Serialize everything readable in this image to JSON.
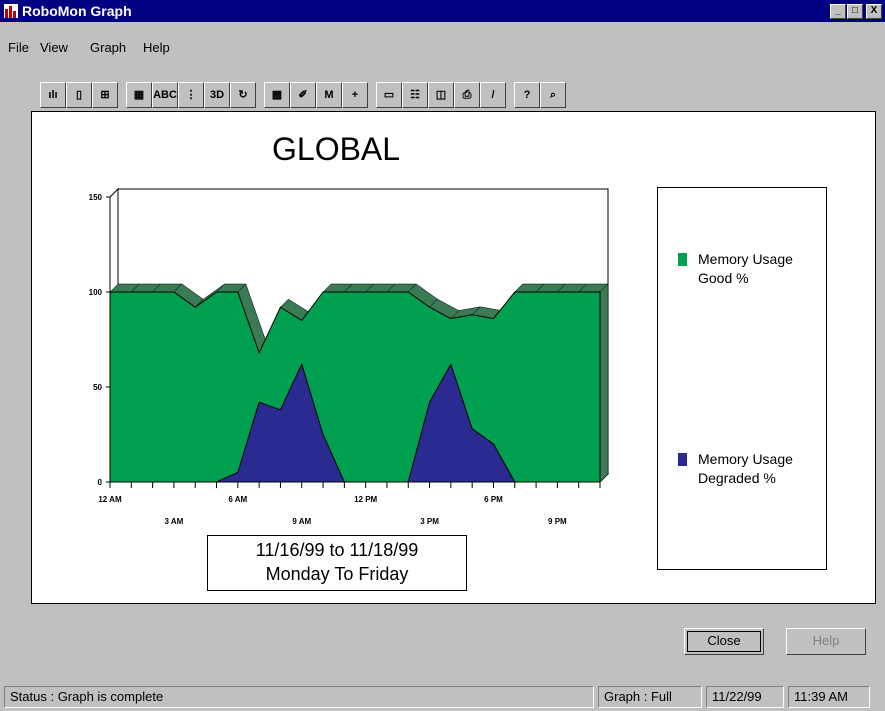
{
  "window": {
    "title": "RoboMon Graph",
    "min": "_",
    "max": "□",
    "close": "X"
  },
  "menu": {
    "items": [
      "File",
      "View",
      "Graph",
      "Help"
    ]
  },
  "toolbar": {
    "buttons": [
      {
        "icon": "bar-chart-icon",
        "glyph": "ılı"
      },
      {
        "icon": "book-icon",
        "glyph": "▯"
      },
      {
        "icon": "grouped-bars-icon",
        "glyph": "⊞"
      },
      {
        "icon": "data-grid-icon",
        "glyph": "▦"
      },
      {
        "icon": "abc-text-icon",
        "glyph": "ABC"
      },
      {
        "icon": "gridlines-icon",
        "glyph": "⋮"
      },
      {
        "icon": "3d-icon",
        "glyph": "3D"
      },
      {
        "icon": "rotate-icon",
        "glyph": "↻"
      },
      {
        "icon": "pattern-icon",
        "glyph": "▩"
      },
      {
        "icon": "wand-icon",
        "glyph": "✐"
      },
      {
        "icon": "marker-icon",
        "glyph": "M"
      },
      {
        "icon": "crosshair-icon",
        "glyph": "+"
      },
      {
        "icon": "title-icon",
        "glyph": "▭"
      },
      {
        "icon": "legend-icon",
        "glyph": "☷"
      },
      {
        "icon": "tag-icon",
        "glyph": "◫"
      },
      {
        "icon": "print-icon",
        "glyph": "⎙"
      },
      {
        "icon": "pencil-icon",
        "glyph": "/"
      },
      {
        "icon": "help-icon",
        "glyph": "?"
      },
      {
        "icon": "zoom-icon",
        "glyph": "⌕"
      }
    ]
  },
  "colors": {
    "good": "#00a050",
    "good_dark": "#3a7a55",
    "degraded": "#2a2a90",
    "titlebar": "#000080"
  },
  "chart_data": {
    "type": "area",
    "title": "GLOBAL",
    "ylim": [
      0,
      150
    ],
    "yticks": [
      "150",
      "100",
      "50",
      "0"
    ],
    "xticks": [
      "12 AM",
      "3 AM",
      "6 AM",
      "9 AM",
      "12 PM",
      "3 PM",
      "6 PM",
      "9 PM"
    ],
    "x": [
      "12 AM",
      "1 AM",
      "2 AM",
      "3 AM",
      "4 AM",
      "5 AM",
      "6 AM",
      "7 AM",
      "8 AM",
      "9 AM",
      "10 AM",
      "11 AM",
      "12 PM",
      "1 PM",
      "2 PM",
      "3 PM",
      "4 PM",
      "5 PM",
      "6 PM",
      "7 PM",
      "8 PM",
      "9 PM",
      "10 PM",
      "11 PM"
    ],
    "series": [
      {
        "name": "Memory Usage\nGood %",
        "values": [
          100,
          100,
          100,
          100,
          92,
          100,
          100,
          68,
          92,
          85,
          100,
          100,
          100,
          100,
          100,
          92,
          86,
          88,
          86,
          100,
          100,
          100,
          100,
          100
        ]
      },
      {
        "name": "Memory Usage\nDegraded %",
        "values": [
          0,
          0,
          0,
          0,
          0,
          0,
          5,
          42,
          38,
          62,
          25,
          0,
          0,
          0,
          0,
          42,
          62,
          28,
          20,
          0,
          0,
          0,
          0,
          0
        ]
      }
    ],
    "grid": false,
    "legend_position": "right"
  },
  "date_box": {
    "line1": "11/16/99  to  11/18/99",
    "line2": "Monday To Friday"
  },
  "buttons": {
    "close": "Close",
    "help": "Help"
  },
  "status": {
    "text": "Status : Graph is complete",
    "graph": "Graph : Full",
    "date": "11/22/99",
    "time": "11:39 AM"
  }
}
